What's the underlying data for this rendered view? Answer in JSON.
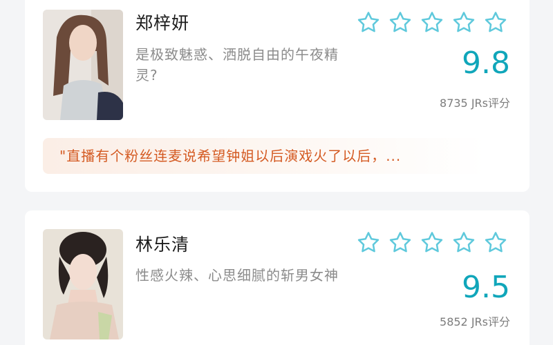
{
  "cards": [
    {
      "name": "郑梓妍",
      "description": "是极致魅惑、洒脱自由的午夜精灵?",
      "stars": 5,
      "score": "9.8",
      "rating_count": "8735 JRs评分",
      "quote": "\"直播有个粉丝连麦说希望钟姐以后演戏火了以后，..."
    },
    {
      "name": "林乐清",
      "description": "性感火辣、心思细腻的斩男女神",
      "stars": 5,
      "score": "9.5",
      "rating_count": "5852 JRs评分"
    }
  ],
  "colors": {
    "accent": "#10a6ba",
    "star_outline": "#5fc9dc",
    "quote_text": "#d45a22"
  }
}
